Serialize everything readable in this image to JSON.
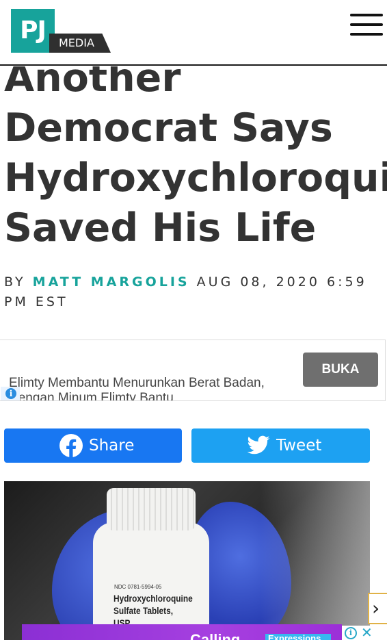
{
  "header": {
    "logo_main": "PJ",
    "logo_sub": "MEDIA"
  },
  "article": {
    "title_lines": [
      "Another",
      "Democrat Says",
      "Hydroxychloroquine",
      "Saved His Life"
    ],
    "byline_prefix": "BY",
    "author": "MATT MARGOLIS",
    "date": "AUG 08, 2020 6:59 PM EST"
  },
  "ad": {
    "text": "Elimty Membantu Menurunkan Berat Badan, Dengan Minum Elimty Bantu",
    "button_label": "BUKA"
  },
  "share": {
    "facebook_label": "Share",
    "twitter_label": "Tweet"
  },
  "photo": {
    "ndc_text": "NDC 0781-5994-05",
    "drug_name": "Hydroxychloroquine Sulfate Tablets, USP"
  },
  "bottom_ad": {
    "headline": "Calling",
    "tag": "Expressions"
  },
  "colors": {
    "brand_teal": "#17a39b",
    "facebook_blue": "#1877f2",
    "twitter_blue": "#1da1f2",
    "ad_button_gray": "#6f6f6f"
  },
  "icons": {
    "menu": "hamburger-menu-icon",
    "facebook": "facebook-icon",
    "twitter": "twitter-bird-icon",
    "ad_info": "info-icon",
    "close": "close-icon",
    "next": "chevron-right-icon"
  }
}
